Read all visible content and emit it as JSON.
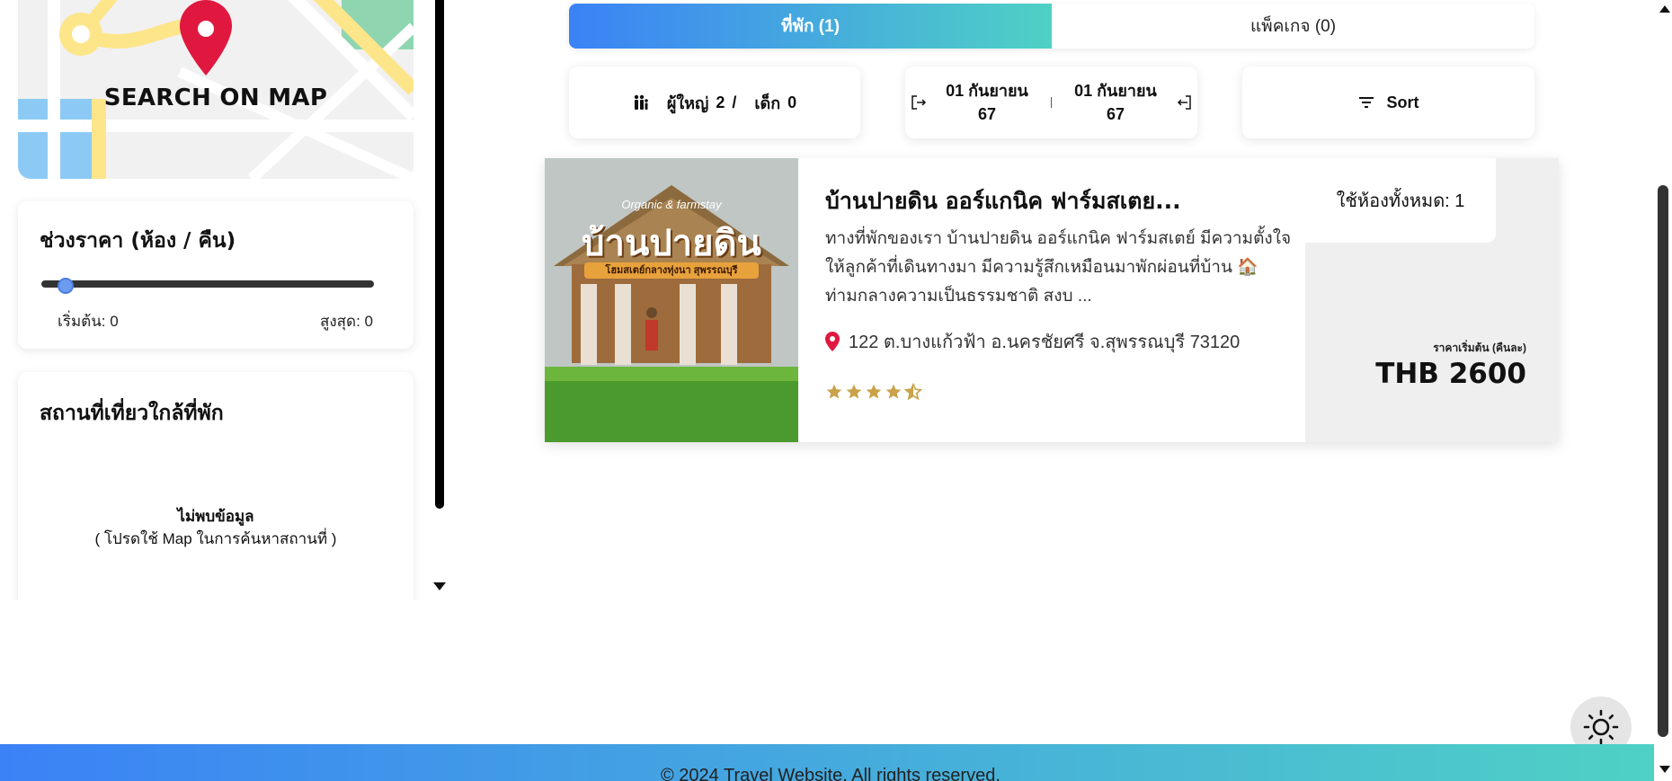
{
  "sidebar": {
    "map_label": "SEARCH ON MAP",
    "price_filter": {
      "title": "ช่วงราคา (ห้อง / คืน)",
      "min_label": "เริ่มต้น: 0",
      "max_label": "สูงสุด: 0",
      "value_fraction": 0.0
    },
    "nearby": {
      "title": "สถานที่เที่ยวใกล้ที่พัก",
      "empty_title": "ไม่พบข้อมูล",
      "empty_hint": "( โปรดใช้ Map ในการค้นหาสถานที่ )"
    }
  },
  "tabs": [
    {
      "label": "ที่พัก (1)",
      "active": true
    },
    {
      "label": "แพ็คเกจ (0)",
      "active": false
    }
  ],
  "filters": {
    "guests": {
      "adults_label": "ผู้ใหญ่",
      "adults": "2",
      "separator": "/",
      "children_label": "เด็ก",
      "children": "0",
      "icon": "people-icon"
    },
    "dates": {
      "checkin_day_month": "01 กันยายน",
      "checkin_year": "67",
      "checkout_day_month": "01 กันยายน",
      "checkout_year": "67",
      "checkin_icon": "login-icon",
      "checkout_icon": "logout-icon"
    },
    "sort": {
      "label": "Sort",
      "icon": "filter-icon"
    }
  },
  "listing": {
    "image_text": {
      "subtitle": "Organic & farmstay",
      "name": "บ้านปายดิน",
      "tagline": "โฮมสเตย์กลางทุ่งนา สุพรรณบุรี"
    },
    "title": "บ้านปายดิน ออร์แกนิค ฟาร์มสเตย...",
    "description": "ทางที่พักของเรา บ้านปายดิน ออร์แกนิค ฟาร์มสเตย์ มีความตั้งใจให้ลูกค้าที่เดินทางมา มีความรู้สึกเหมือนมาพักผ่อนที่บ้าน 🏠 ท่ามกลางความเป็นธรรมชาติ สงบ ...",
    "address": "122 ต.บางแก้วฟ้า อ.นครชัยศรี จ.สุพรรณบุรี 73120",
    "rating": 4.5,
    "rooms_label": "ใช้ห้องทั้งหมด: 1",
    "price_caption": "ราคาเริ่มต้น (คืนละ)",
    "price": "THB 2600"
  },
  "footer": {
    "text": "© 2024 Travel Website. All rights reserved."
  },
  "colors": {
    "accent_start": "#3b82f6",
    "accent_end": "#4fd1c5",
    "pin": "#e0183f",
    "star": "#c9a24a"
  }
}
